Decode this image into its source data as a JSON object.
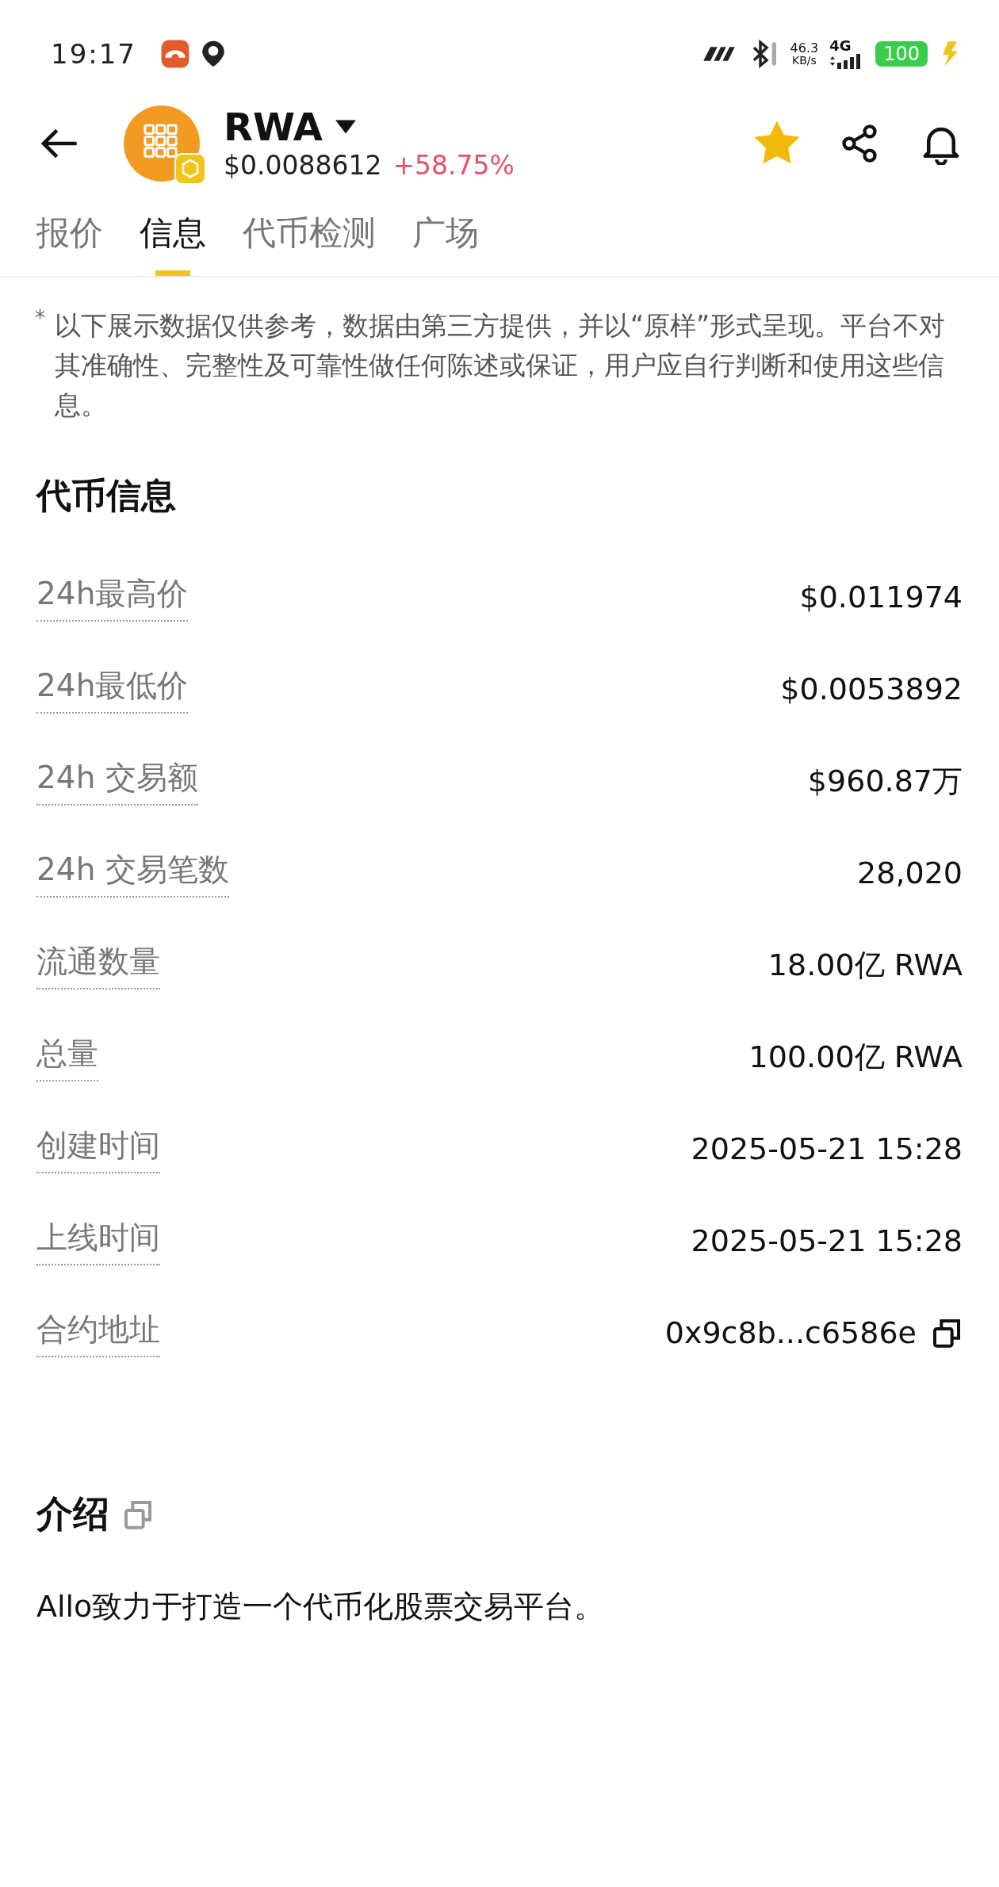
{
  "status_bar": {
    "time": "19:17",
    "net_speed": "46.3",
    "net_unit": "KB/s",
    "network": "4G",
    "battery": "100",
    "charging": true
  },
  "header": {
    "symbol": "RWA",
    "price": "$0.0088612",
    "change": "+58.75%",
    "favorite": true
  },
  "tabs": [
    {
      "label": "报价",
      "selected": false
    },
    {
      "label": "信息",
      "selected": true
    },
    {
      "label": "代币检测",
      "selected": false
    },
    {
      "label": "广场",
      "selected": false
    }
  ],
  "disclaimer": {
    "mark": "*",
    "text": "以下展示数据仅供参考，数据由第三方提供，并以“原样”形式呈现。平台不对其准确性、完整性及可靠性做任何陈述或保证，用户应自行判断和使用这些信息。"
  },
  "token_info": {
    "title": "代币信息",
    "rows": [
      {
        "label": "24h最高价",
        "value": "$0.011974"
      },
      {
        "label": "24h最低价",
        "value": "$0.0053892"
      },
      {
        "label": "24h 交易额",
        "value": "$960.87万"
      },
      {
        "label": "24h 交易笔数",
        "value": "28,020"
      },
      {
        "label": "流通数量",
        "value": "18.00亿 RWA"
      },
      {
        "label": "总量",
        "value": "100.00亿 RWA"
      },
      {
        "label": "创建时间",
        "value": "2025-05-21 15:28"
      },
      {
        "label": "上线时间",
        "value": "2025-05-21 15:28"
      },
      {
        "label": "合约地址",
        "value": "0x9c8b...c6586e",
        "copyable": true
      }
    ]
  },
  "intro": {
    "title": "介绍",
    "text": "Allo致力于打造一个代币化股票交易平台。"
  }
}
